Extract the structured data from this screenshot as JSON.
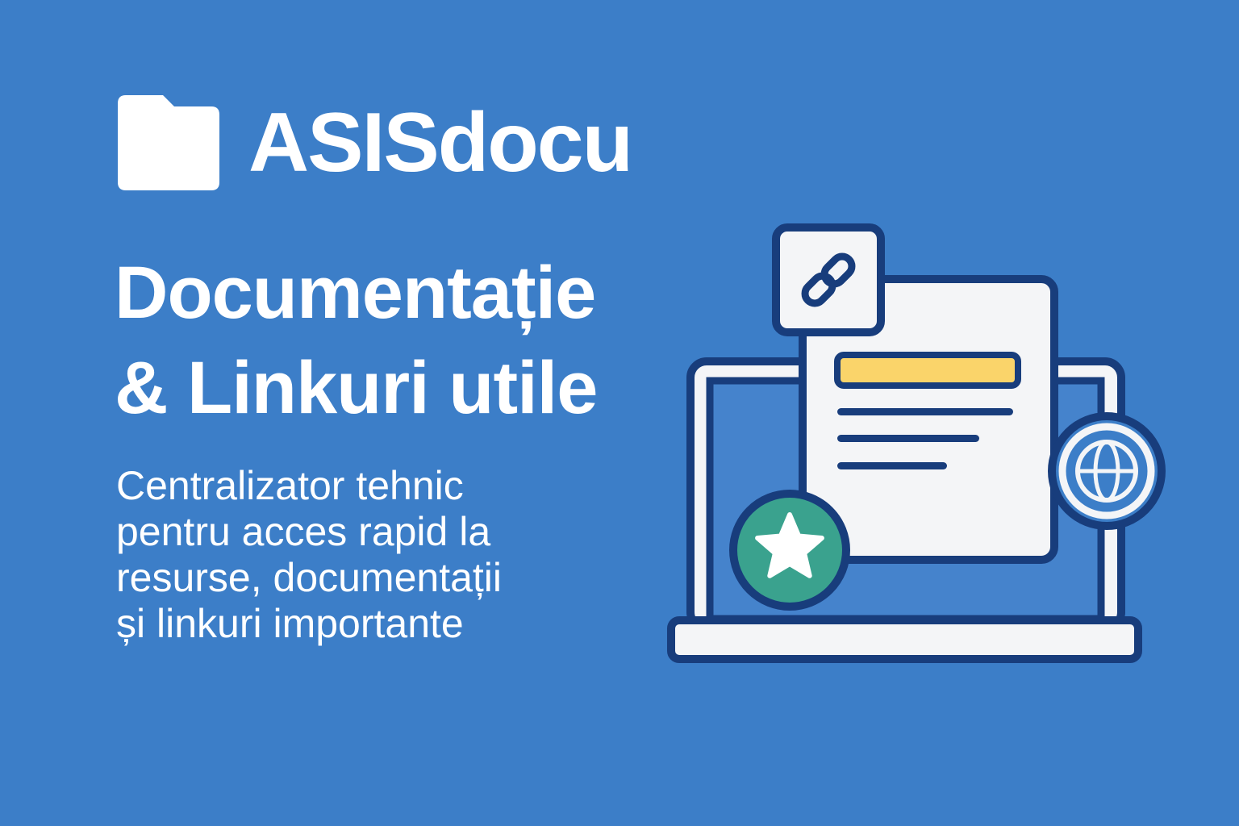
{
  "brand": {
    "name": "ASISdocu",
    "icon": "folder-icon"
  },
  "headline": {
    "line1": "Documentație",
    "line2": "& Linkuri utile"
  },
  "subtitle": {
    "line1": "Centralizator tehnic",
    "line2": "pentru acces rapid la",
    "line3": "resurse, documentații",
    "line4": "și linkuri importante"
  },
  "illustration": {
    "icons": [
      "laptop-icon",
      "document-icon",
      "link-icon",
      "star-icon",
      "globe-icon"
    ]
  },
  "colors": {
    "background": "#3c7ec8",
    "outline": "#183d7c",
    "highlight": "#fad46a",
    "star_badge": "#3aa28e",
    "document": "#f4f5f7"
  }
}
